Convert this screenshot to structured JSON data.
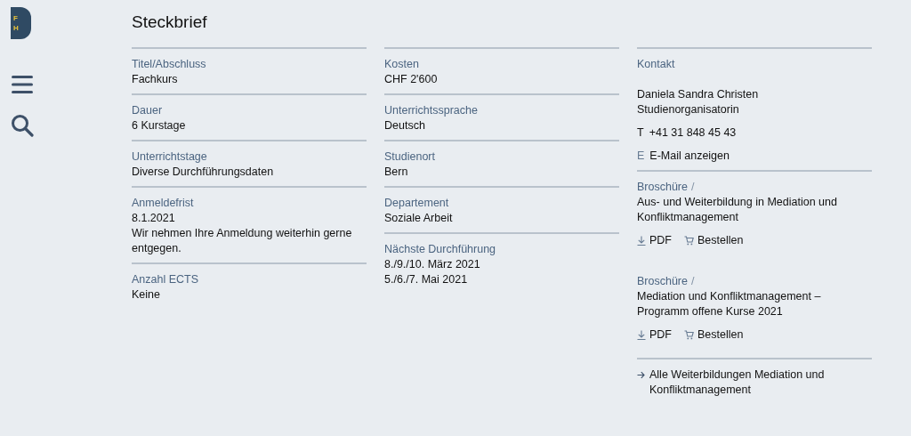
{
  "logo": {
    "letters": [
      "F",
      "H"
    ]
  },
  "nav": [
    {
      "kind": "menu"
    },
    {
      "kind": "search"
    }
  ],
  "title": "Steckbrief",
  "columns": [
    {
      "fields": [
        {
          "label": "Titel/Abschluss",
          "values": [
            "Fachkurs"
          ]
        },
        {
          "label": "Dauer",
          "values": [
            "6 Kurstage"
          ]
        },
        {
          "label": "Unterrichtstage",
          "values": [
            "Diverse Durchführungsdaten"
          ]
        },
        {
          "label": "Anmeldefrist",
          "values": [
            "8.1.2021",
            "Wir nehmen Ihre Anmeldung weiterhin gerne entgegen."
          ]
        },
        {
          "label": "Anzahl ECTS",
          "values": [
            "Keine"
          ]
        }
      ]
    },
    {
      "fields": [
        {
          "label": "Kosten",
          "values": [
            "CHF 2'600"
          ]
        },
        {
          "label": "Unterrichtssprache",
          "values": [
            "Deutsch"
          ]
        },
        {
          "label": "Studienort",
          "values": [
            "Bern"
          ]
        },
        {
          "label": "Departement",
          "values": [
            "Soziale Arbeit"
          ]
        },
        {
          "label": "Nächste Durchführung",
          "values": [
            "8./9./10. März 2021",
            "5./6./7. Mai 2021"
          ]
        }
      ]
    }
  ],
  "contact": {
    "label": "Kontakt",
    "name": "Daniela Sandra Christen",
    "role": "Studienorganisatorin",
    "phone": {
      "prefix": "T",
      "value": "+41 31 848 45 43"
    },
    "email": {
      "prefix": "E",
      "link": "E-Mail anzeigen"
    }
  },
  "brochures": [
    {
      "label": "Broschüre",
      "separator": "/",
      "title": "Aus- und Weiterbildung in Mediation und Konfliktmanagement",
      "actions": [
        {
          "kind": "download",
          "label": "PDF"
        },
        {
          "kind": "order",
          "label": "Bestellen"
        }
      ]
    },
    {
      "label": "Broschüre",
      "separator": "/",
      "title": "Mediation und Konfliktmanagement – Programm offene Kurse 2021",
      "actions": [
        {
          "kind": "download",
          "label": "PDF"
        },
        {
          "kind": "order",
          "label": "Bestellen"
        }
      ]
    }
  ],
  "more_link": "Alle Weiterbildungen Mediation und Konfliktmanagement"
}
